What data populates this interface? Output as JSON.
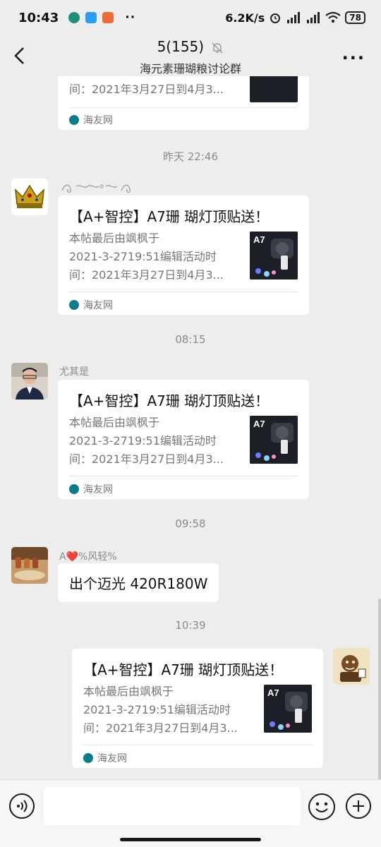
{
  "status": {
    "time": "10:43",
    "net_speed": "6.2K/s",
    "battery": "78"
  },
  "header": {
    "title": "5(155)",
    "subtitle": "海元素珊瑚粮讨论群"
  },
  "messages": {
    "top_card": {
      "desc_line3": "间：2021年3月27日到4月3...",
      "source": "海友网"
    },
    "time1": "昨天 22:46",
    "msg1": {
      "sender": "",
      "title": "【A+智控】A7珊 瑚灯顶贴送！",
      "desc_line1": "本帖最后由飒枫于",
      "desc_line2": "2021-3-2719:51编辑活动时",
      "desc_line3": "间：2021年3月27日到4月3...",
      "source": "海友网"
    },
    "time2": "08:15",
    "msg2": {
      "sender": "尤其是",
      "title": "【A+智控】A7珊 瑚灯顶贴送！",
      "desc_line1": "本帖最后由飒枫于",
      "desc_line2": "2021-3-2719:51编辑活动时",
      "desc_line3": "间：2021年3月27日到4月3...",
      "source": "海友网"
    },
    "time3": "09:58",
    "msg3": {
      "sender_prefix": "A",
      "sender_suffix": "%风轻%",
      "text": "出个迈光 420R180W"
    },
    "time4": "10:39",
    "msg4": {
      "title": "【A+智控】A7珊 瑚灯顶贴送！",
      "desc_line1": "本帖最后由飒枫于",
      "desc_line2": "2021-3-2719:51编辑活动时",
      "desc_line3": "间：2021年3月27日到4月3...",
      "source": "海友网"
    }
  },
  "thumb": {
    "label": "A7"
  },
  "input": {
    "value": ""
  },
  "colors": {
    "background": "#ededed",
    "bubble": "#ffffff",
    "source_icon": "#0a7c8c"
  }
}
